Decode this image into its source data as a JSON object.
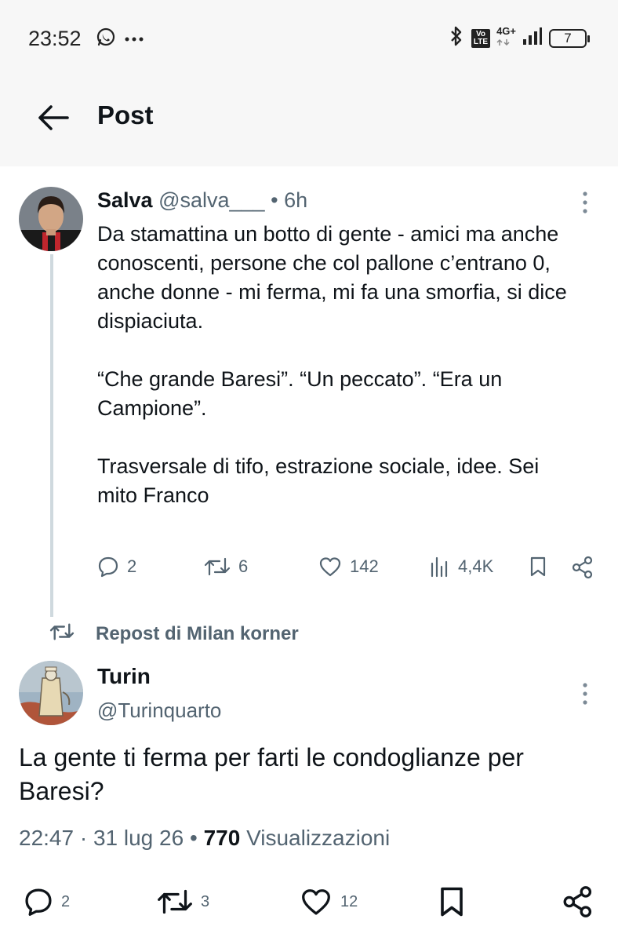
{
  "status_bar": {
    "time": "23:52",
    "volte_top": "Vo",
    "volte_bottom": "LTE",
    "network": "4G+",
    "battery": "7"
  },
  "header": {
    "title": "Post"
  },
  "tweet1": {
    "name": "Salva",
    "handle": "@salva___",
    "separator": "•",
    "time": "6h",
    "body": [
      "Da stamattina un botto di gente - amici ma anche conoscenti, persone che col pallone c’entrano 0, anche donne - mi ferma, mi fa una smorfia, si dice dispiaciuta.",
      "“Che grande Baresi”. “Un peccato”. “Era un Campione”.",
      "Trasversale di tifo, estrazione sociale, idee. Sei mito Franco"
    ],
    "replies": "2",
    "reposts": "6",
    "likes": "142",
    "views": "4,4K"
  },
  "repost_banner": {
    "label": "Repost di Milan korner"
  },
  "tweet2": {
    "name": "Turin",
    "handle": "@Turinquarto",
    "body": "La gente ti ferma per farti le condoglianze per Baresi?",
    "time": "22:47",
    "date": "31 lug 26",
    "views_count": "770",
    "views_label": "Visualizzazioni",
    "replies": "2",
    "reposts": "3",
    "likes": "12"
  },
  "colors": {
    "text": "#0f1419",
    "muted": "#536471",
    "thread_line": "#cfd9de",
    "header_bg": "#f7f7f7"
  }
}
